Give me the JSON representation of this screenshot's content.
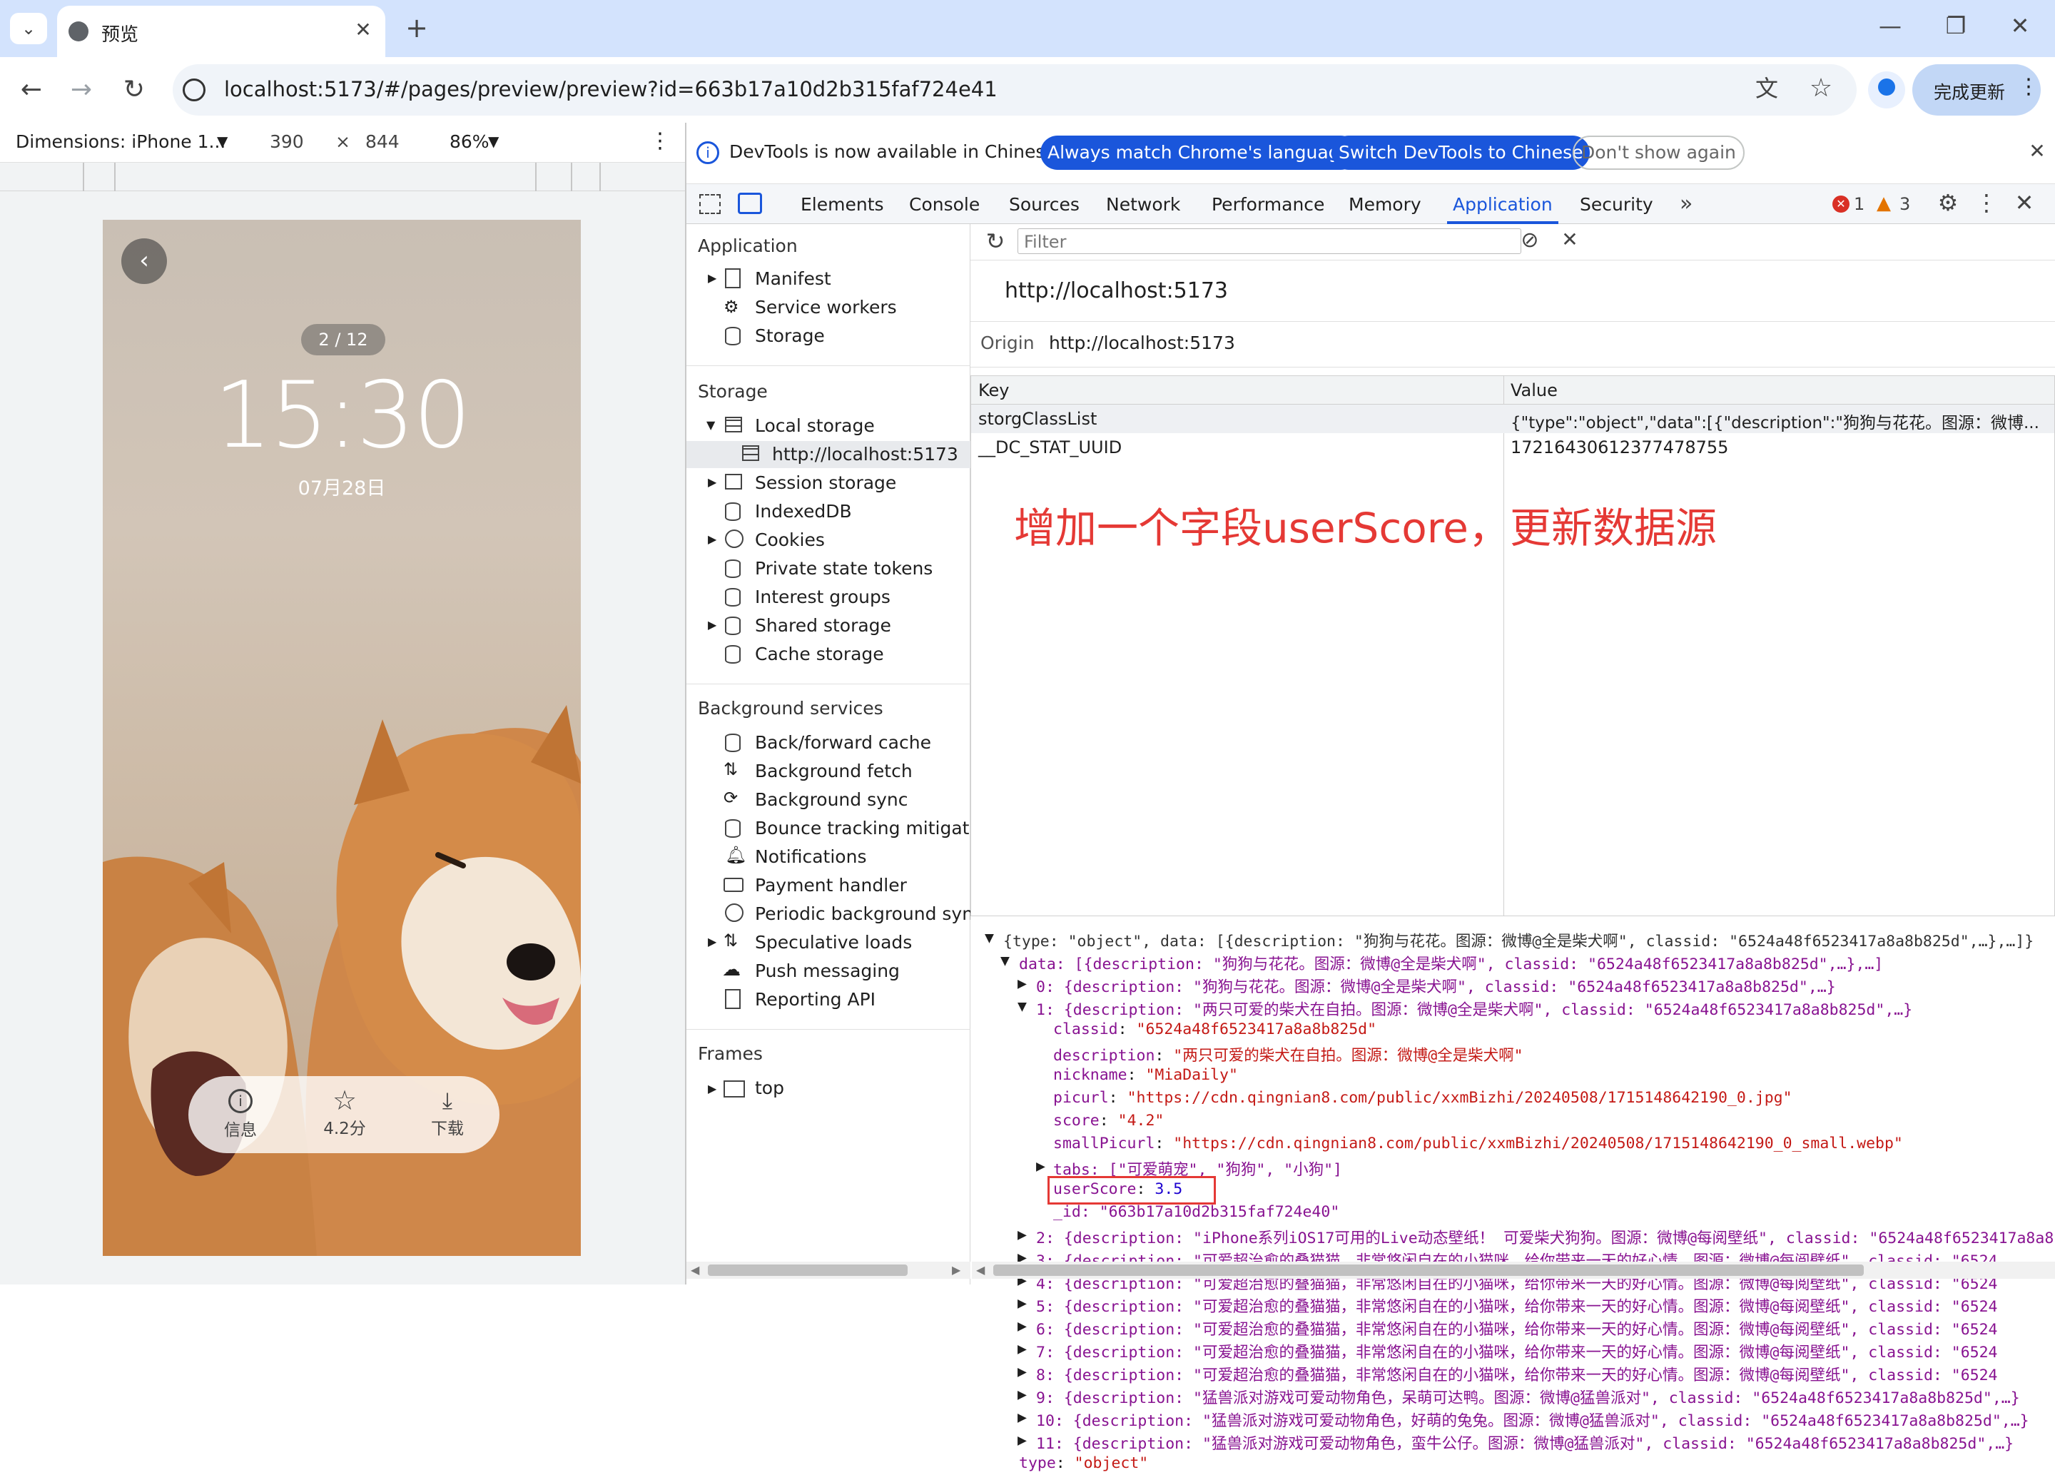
{
  "browser": {
    "tab_title": "预览",
    "url": "localhost:5173/#/pages/preview/preview?id=663b17a10d2b315faf724e41",
    "update_label": "完成更新"
  },
  "device_toolbar": {
    "dimensions": "Dimensions: iPhone 1...",
    "width": "390",
    "x": "×",
    "height": "844",
    "zoom": "86%"
  },
  "phone": {
    "counter": "2 / 12",
    "time": "15:30",
    "date": "07月28日",
    "actions": [
      {
        "icon": "info-icon",
        "label": "信息"
      },
      {
        "icon": "star-icon",
        "label": "4.2分"
      },
      {
        "icon": "download-icon",
        "label": "下载"
      }
    ]
  },
  "infobar": {
    "message": "DevTools is now available in Chinese!",
    "btn1": "Always match Chrome's language",
    "btn2": "Switch DevTools to Chinese",
    "btn3": "Don't show again"
  },
  "devtools_tabs": [
    "Elements",
    "Console",
    "Sources",
    "Network",
    "Performance",
    "Memory",
    "Application",
    "Security"
  ],
  "active_tab": "Application",
  "errors": "1",
  "warnings": "3",
  "sidebar": {
    "application_title": "Application",
    "application_items": [
      "Manifest",
      "Service workers",
      "Storage"
    ],
    "storage_title": "Storage",
    "storage_items": [
      "Local storage",
      "http://localhost:5173",
      "Session storage",
      "IndexedDB",
      "Cookies",
      "Private state tokens",
      "Interest groups",
      "Shared storage",
      "Cache storage"
    ],
    "bg_title": "Background services",
    "bg_items": [
      "Back/forward cache",
      "Background fetch",
      "Background sync",
      "Bounce tracking mitigation",
      "Notifications",
      "Payment handler",
      "Periodic background sync",
      "Speculative loads",
      "Push messaging",
      "Reporting API"
    ],
    "frames_title": "Frames",
    "frames_items": [
      "top"
    ]
  },
  "storage_panel": {
    "filter_placeholder": "Filter",
    "origin_heading": "http://localhost:5173",
    "origin_label": "Origin",
    "origin_value": "http://localhost:5173",
    "col_key": "Key",
    "col_value": "Value",
    "rows": [
      {
        "key": "storgClassList",
        "value": "{\"type\":\"object\",\"data\":[{\"description\":\"狗狗与花花。图源：微博..."
      },
      {
        "key": "__DC_STAT_UUID",
        "value": "17216430612377478755"
      }
    ],
    "annotation": "增加一个字段userScore，更新数据源"
  },
  "tree": {
    "root": "{type: \"object\", data: [{description: \"狗狗与花花。图源：微博@全是柴犬啊\", classid: \"6524a48f6523417a8a8b825d\",…},…]}",
    "data_line": "data: [{description: \"狗狗与花花。图源：微博@全是柴犬啊\", classid: \"6524a48f6523417a8a8b825d\",…},…]",
    "item0": "0: {description: \"狗狗与花花。图源：微博@全是柴犬啊\", classid: \"6524a48f6523417a8a8b825d\",…}",
    "item1": "1: {description: \"两只可爱的柴犬在自拍。图源：微博@全是柴犬啊\", classid: \"6524a48f6523417a8a8b825d\",…}",
    "fields": [
      {
        "k": "classid",
        "v": "\"6524a48f6523417a8a8b825d\""
      },
      {
        "k": "description",
        "v": "\"两只可爱的柴犬在自拍。图源：微博@全是柴犬啊\""
      },
      {
        "k": "nickname",
        "v": "\"MiaDaily\""
      },
      {
        "k": "picurl",
        "v": "\"https://cdn.qingnian8.com/public/xxmBizhi/20240508/1715148642190_0.jpg\""
      },
      {
        "k": "score",
        "v": "\"4.2\""
      },
      {
        "k": "smallPicurl",
        "v": "\"https://cdn.qingnian8.com/public/xxmBizhi/20240508/1715148642190_0_small.webp\""
      }
    ],
    "tabs_line": "tabs: [\"可爱萌宠\", \"狗狗\", \"小狗\"]",
    "userscore_key": "userScore",
    "userscore_val": "3.5",
    "id_line": "_id: \"663b17a10d2b315faf724e40\"",
    "rest": [
      "2: {description: \"iPhone系列iOS17可用的Live动态壁纸！ 可爱柴犬狗狗。图源：微博@每阅壁纸\", classid: \"6524a48f6523417a8a8",
      "3: {description: \"可爱超治愈的叠猫猫，非常悠闲自在的小猫咪，给你带来一天的好心情。图源：微博@每阅壁纸\", classid: \"6524",
      "4: {description: \"可爱超治愈的叠猫猫，非常悠闲自在的小猫咪，给你带来一天的好心情。图源：微博@每阅壁纸\", classid: \"6524",
      "5: {description: \"可爱超治愈的叠猫猫，非常悠闲自在的小猫咪，给你带来一天的好心情。图源：微博@每阅壁纸\", classid: \"6524",
      "6: {description: \"可爱超治愈的叠猫猫，非常悠闲自在的小猫咪，给你带来一天的好心情。图源：微博@每阅壁纸\", classid: \"6524",
      "7: {description: \"可爱超治愈的叠猫猫，非常悠闲自在的小猫咪，给你带来一天的好心情。图源：微博@每阅壁纸\", classid: \"6524",
      "8: {description: \"可爱超治愈的叠猫猫，非常悠闲自在的小猫咪，给你带来一天的好心情。图源：微博@每阅壁纸\", classid: \"6524",
      "9: {description: \"猛兽派对游戏可爱动物角色，呆萌可达鸭。图源：微博@猛兽派对\", classid: \"6524a48f6523417a8a8b825d\",…}",
      "10: {description: \"猛兽派对游戏可爱动物角色，好萌的兔兔。图源：微博@猛兽派对\", classid: \"6524a48f6523417a8a8b825d\",…}",
      "11: {description: \"猛兽派对游戏可爱动物角色，蛮牛公仔。图源：微博@猛兽派对\", classid: \"6524a48f6523417a8a8b825d\",…}"
    ],
    "type_key": "type",
    "type_val": "\"object\""
  }
}
